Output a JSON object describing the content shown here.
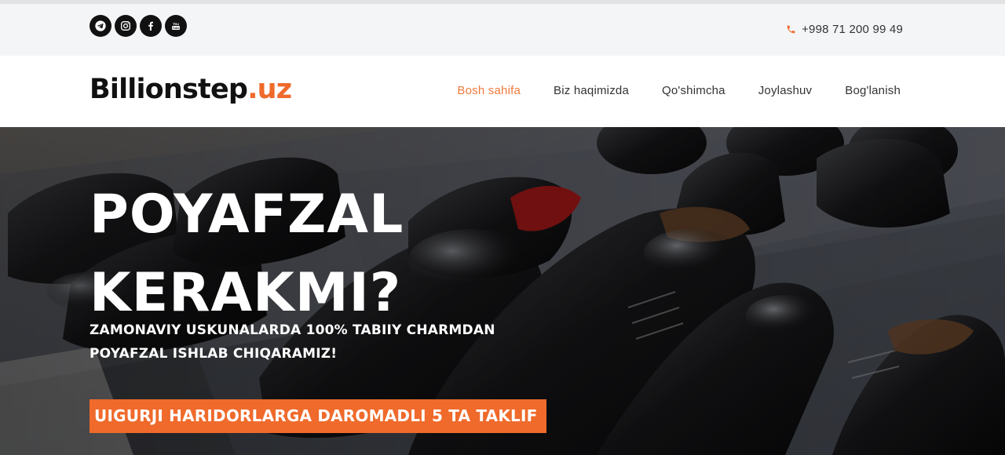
{
  "social_links": [
    {
      "name": "telegram",
      "icon": "telegram-icon"
    },
    {
      "name": "instagram",
      "icon": "instagram-icon"
    },
    {
      "name": "facebook",
      "icon": "facebook-icon"
    },
    {
      "name": "youtube",
      "icon": "youtube-icon"
    }
  ],
  "contact": {
    "phone": "+998 71 200 99 49",
    "icon": "phone-icon"
  },
  "brand": {
    "name": "Billionstep",
    "tld": ".uz"
  },
  "nav": [
    {
      "label": "Bosh sahifa",
      "active": true
    },
    {
      "label": "Biz haqimizda",
      "active": false
    },
    {
      "label": "Qo'shimcha",
      "active": false
    },
    {
      "label": "Joylashuv",
      "active": false
    },
    {
      "label": "Bog'lanish",
      "active": false
    }
  ],
  "hero": {
    "title_line1": "POYAFZAL",
    "title_line2": "KERAKMI?",
    "subtitle_line1": "ZAMONAVIY USKUNALARDA 100% TABIIY CHARMDAN",
    "subtitle_line2": "POYAFZAL ISHLAB CHIQARAMIZ!",
    "cta_label": "UIGURJI HARIDORLARGA DAROMADLI 5 TA TAKLIF"
  },
  "colors": {
    "accent": "#ef6a2b",
    "nav_active": "#ef7a3b",
    "topbar_bg": "#f4f5f7"
  }
}
